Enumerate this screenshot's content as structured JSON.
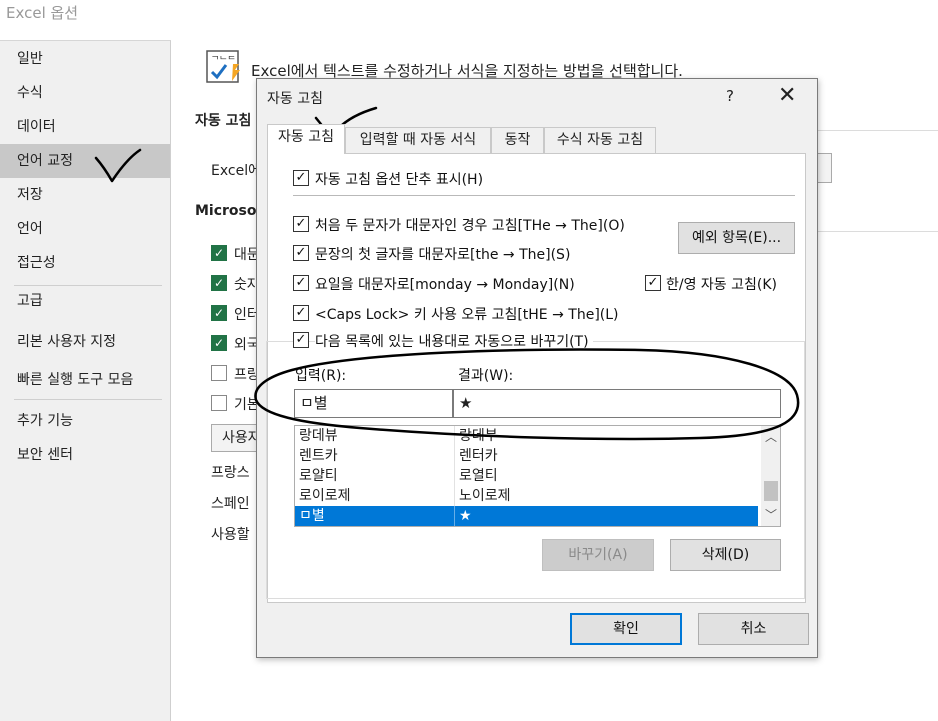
{
  "window": {
    "title": "Excel 옵션"
  },
  "sidebar": {
    "items": [
      {
        "label": "일반"
      },
      {
        "label": "수식"
      },
      {
        "label": "데이터"
      },
      {
        "label": "언어 교정"
      },
      {
        "label": "저장"
      },
      {
        "label": "언어"
      },
      {
        "label": "접근성"
      },
      {
        "label": "고급"
      },
      {
        "label": "리본 사용자 지정"
      },
      {
        "label": "빠른 실행 도구 모음"
      },
      {
        "label": "추가 기능"
      },
      {
        "label": "보안 센터"
      }
    ],
    "selected": "언어 교정"
  },
  "main": {
    "header": "Excel에서 텍스트를 수정하거나 서식을 지정하는 방법을 선택합니다.",
    "section1_title": "자동 고침",
    "section1_text": "Excel에",
    "section2_title": "Microsof",
    "checks": [
      {
        "label": "대문",
        "checked": true
      },
      {
        "label": "숫자",
        "checked": true
      },
      {
        "label": "인터",
        "checked": true
      },
      {
        "label": "외국",
        "checked": true
      },
      {
        "label": "프랑",
        "checked": false
      },
      {
        "label": "기본",
        "checked": false
      }
    ],
    "user_button": "사용자",
    "lines": [
      "프랑스",
      "스페인",
      "사용할"
    ]
  },
  "dialog": {
    "title": "자동 고침",
    "help": "?",
    "close": "✕",
    "tabs": [
      {
        "label": "자동 고침",
        "active": true
      },
      {
        "label": "입력할 때 자동 서식",
        "active": false
      },
      {
        "label": "동작",
        "active": false
      },
      {
        "label": "수식 자동 고침",
        "active": false
      }
    ],
    "show_buttons": {
      "label": "자동 고침 옵션 단추 표시(H)",
      "checked": true
    },
    "options": [
      {
        "label": "처음 두 문자가 대문자인 경우 고침[THe → The](O)",
        "checked": true
      },
      {
        "label": "문장의 첫 글자를 대문자로[the → The](S)",
        "checked": true
      },
      {
        "label": "요일을 대문자로[monday → Monday](N)",
        "checked": true
      },
      {
        "label": "<Caps Lock> 키 사용 오류 고침[tHE → The](L)",
        "checked": true
      },
      {
        "label": "다음 목록에 있는 내용대로 자동으로 바꾸기(T)",
        "checked": true
      }
    ],
    "hanyoung": {
      "label": "한/영 자동 고침(K)",
      "checked": true
    },
    "exceptions_button": "예외 항목(E)...",
    "input_label": "입력(R):",
    "result_label": "결과(W):",
    "input_value": "ㅁ별",
    "result_value": "★",
    "list": [
      {
        "input": "랑데뷰",
        "result": "랑데부",
        "selected": false
      },
      {
        "input": "렌트카",
        "result": "렌터카",
        "selected": false
      },
      {
        "input": "로얄티",
        "result": "로열티",
        "selected": false
      },
      {
        "input": "로이로제",
        "result": "노이로제",
        "selected": false
      },
      {
        "input": "ㅁ별",
        "result": "★",
        "selected": true
      }
    ],
    "replace_button": "바꾸기(A)",
    "delete_button": "삭제(D)",
    "ok_button": "확인",
    "cancel_button": "취소"
  },
  "colors": {
    "selection": "#0078d7",
    "excel_green": "#217346",
    "ink": "#000000"
  }
}
